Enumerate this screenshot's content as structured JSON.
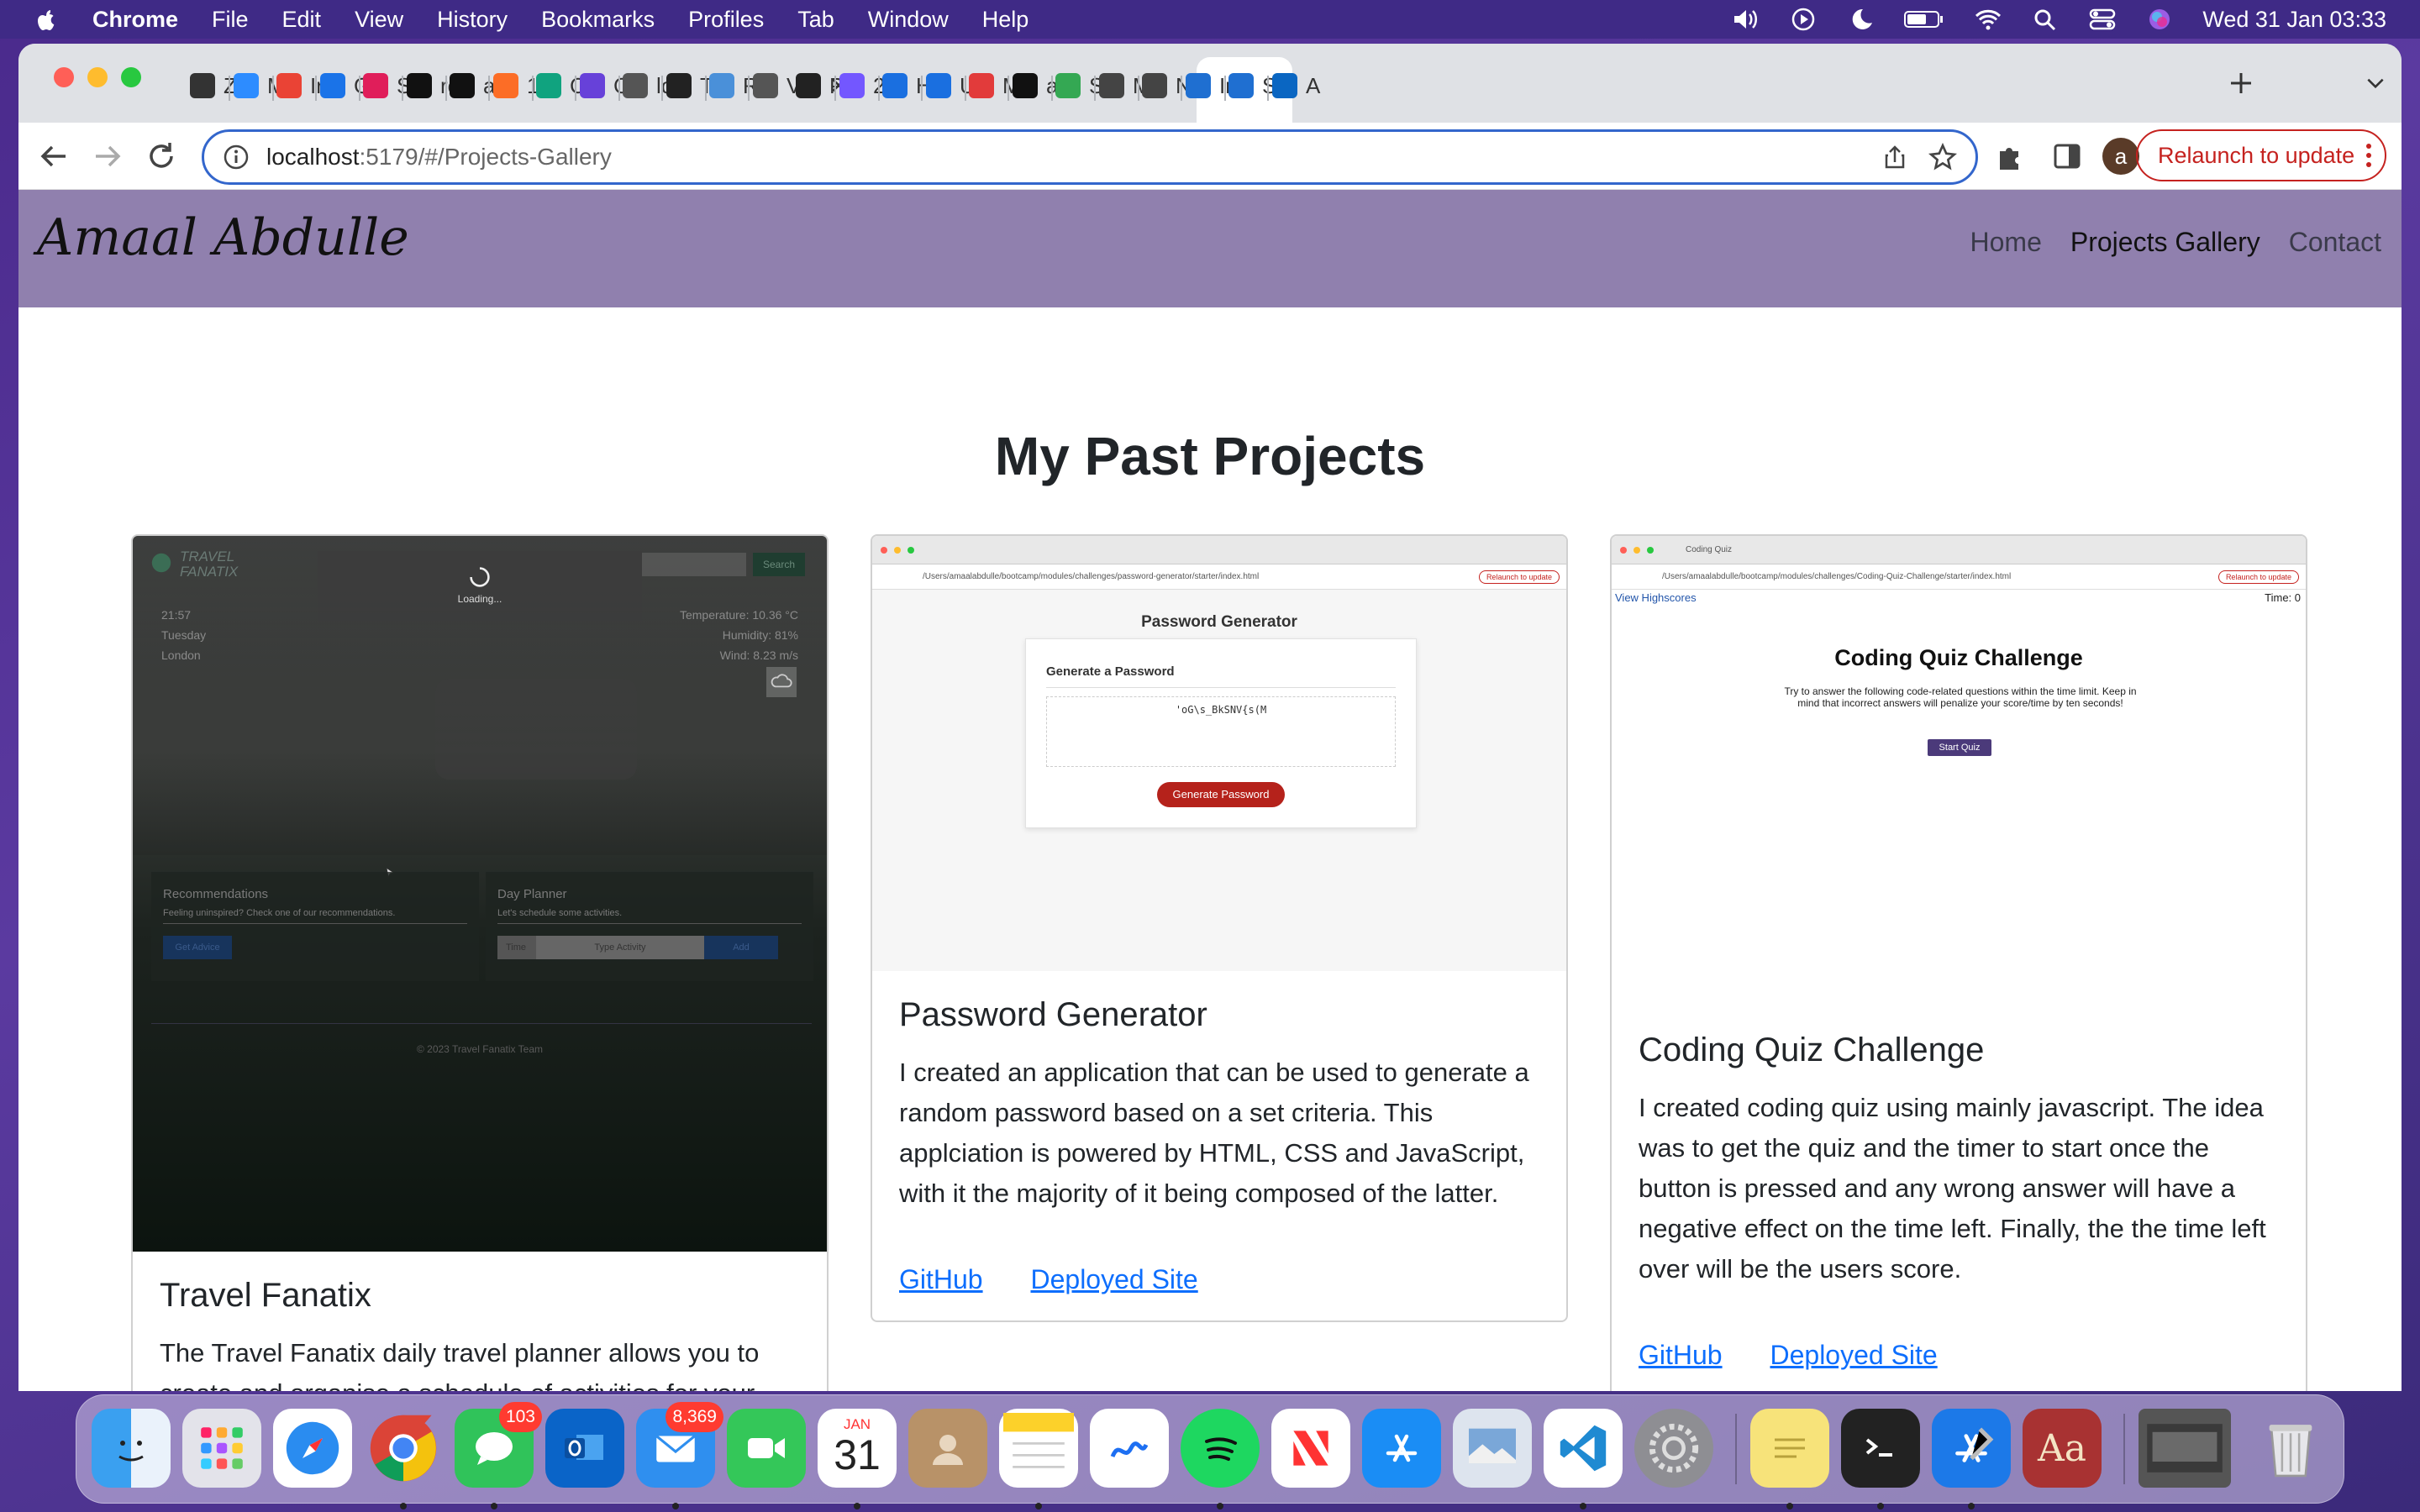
{
  "menubar": {
    "app_name": "Chrome",
    "items": [
      "File",
      "Edit",
      "View",
      "History",
      "Bookmarks",
      "Profiles",
      "Tab",
      "Window",
      "Help"
    ],
    "datetime": "Wed 31 Jan  03:33"
  },
  "browser": {
    "tabs": [
      {
        "short": "Z"
      },
      {
        "short": "M"
      },
      {
        "short": "Ir"
      },
      {
        "short": "G"
      },
      {
        "short": "S"
      },
      {
        "short": "re"
      },
      {
        "short": "a"
      },
      {
        "short": "1:"
      },
      {
        "short": "C"
      },
      {
        "short": "C"
      },
      {
        "short": "lc"
      },
      {
        "short": "T"
      },
      {
        "short": "R"
      },
      {
        "short": "V",
        "active": true
      },
      {
        "short": "P"
      },
      {
        "short": "2"
      },
      {
        "short": "H"
      },
      {
        "short": "U"
      },
      {
        "short": "M"
      },
      {
        "short": "a"
      },
      {
        "short": "S"
      },
      {
        "short": "M"
      },
      {
        "short": "N"
      },
      {
        "short": "Ir"
      },
      {
        "short": "S"
      },
      {
        "short": "A"
      }
    ],
    "url_host": "localhost",
    "url_path": ":5179/#/Projects-Gallery",
    "relaunch_label": "Relaunch to update",
    "profile_initial": "a"
  },
  "site": {
    "name": "Amaal Abdulle",
    "nav": [
      "Home",
      "Projects Gallery",
      "Contact"
    ],
    "active_nav": "Projects Gallery",
    "heading": "My Past Projects"
  },
  "projects": [
    {
      "title": "Travel Fanatix",
      "description": "The Travel Fanatix daily travel planner allows you to create and organise a schedule of activities for your day.The travel planner will provide you with five",
      "thumb": {
        "brand": "TRAVEL FANATIX",
        "loading": "Loading...",
        "search_btn": "Search",
        "time": "21:57",
        "day": "Tuesday",
        "city": "London",
        "temperature": "Temperature: 10.36 °C",
        "humidity": "Humidity: 81%",
        "wind": "Wind: 8.23 m/s",
        "recommendations_title": "Recommendations",
        "recommendations_text": "Feeling uninspired? Check one of our recommendations.",
        "advice_btn": "Get Advice",
        "planner_title": "Day Planner",
        "planner_text": "Let's schedule some activities.",
        "time_placeholder": "Time",
        "activity_placeholder": "Type Activity",
        "add_btn": "Add",
        "footer": "© 2023 Travel Fanatix Team"
      }
    },
    {
      "title": "Password Generator",
      "description": "I created an application that can be used to generate a random password based on a set criteria. This applciation is powered by HTML, CSS and JavaScript, with it the majority of it being composed of the latter.",
      "links": [
        "GitHub",
        "Deployed Site"
      ],
      "thumb": {
        "page_title": "Password Generator",
        "card_title": "Generate a Password",
        "password": "'oG\\s_BkSNV{s(M",
        "button": "Generate Password",
        "address": "/Users/amaalabdulle/bootcamp/modules/challenges/password-generator/starter/index.html"
      }
    },
    {
      "title": "Coding Quiz Challenge",
      "description": "I created coding quiz using mainly javascript. The idea was to get the quiz and the timer to start once the button is pressed and any wrong answer will have a negative effect on the time left. Finally, the the time left over will be the users score.",
      "links": [
        "GitHub",
        "Deployed Site"
      ],
      "thumb": {
        "tab_title": "Coding Quiz",
        "view_highscores": "View Highscores",
        "timer": "Time: 0",
        "heading": "Coding Quiz Challenge",
        "intro": "Try to answer the following code-related questions within the time limit. Keep in mind that incorrect answers will penalize your score/time by ten seconds!",
        "start_button": "Start Quiz",
        "address": "/Users/amaalabdulle/bootcamp/modules/challenges/Coding-Quiz-Challenge/starter/index.html"
      }
    }
  ],
  "dock": {
    "apps": [
      "Finder",
      "Launchpad",
      "Safari",
      "Chrome",
      "Messages",
      "Outlook",
      "Mail",
      "FaceTime",
      "Calendar",
      "Contacts",
      "Notes",
      "Freeform",
      "Spotify",
      "News",
      "App Store",
      "Preview",
      "VS Code",
      "System Settings",
      "Stickies",
      "Terminal",
      "Xcode",
      "Dictionary"
    ],
    "messages_badge": "103",
    "mail_badge": "8,369",
    "calendar_month": "JAN",
    "calendar_day": "31"
  },
  "colors": {
    "header_bg": "#9080ae",
    "link": "#0d6efd",
    "generate_button": "#b5221b",
    "quiz_button": "#4b3a7a"
  }
}
